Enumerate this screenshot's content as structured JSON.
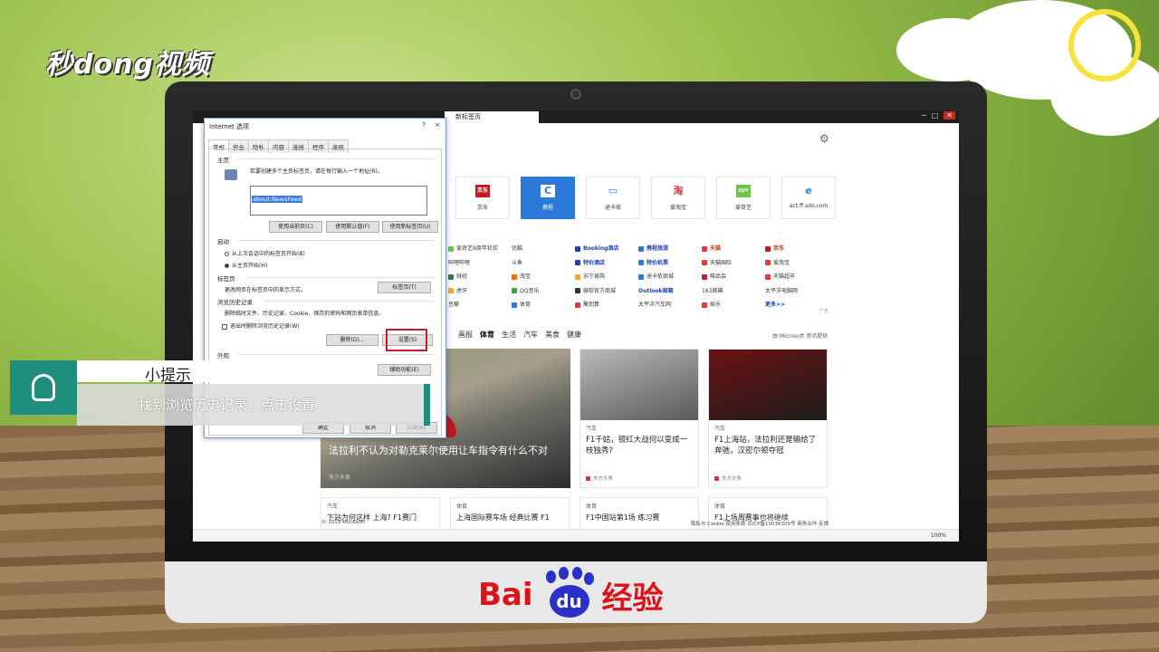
{
  "watermark": {
    "logo": "秒dong视频"
  },
  "brand": {
    "baidu_text": "Bai",
    "baidu_du": "du",
    "baidu_suffix": "经验"
  },
  "browser": {
    "tab_label": "新标签页",
    "window_buttons": [
      "─",
      "□",
      "✕"
    ],
    "top_tiles": [
      {
        "label": "京东",
        "icon": "京东"
      },
      {
        "label": "携程",
        "icon": "C",
        "active": true
      },
      {
        "label": "途卡依",
        "icon": "▭"
      },
      {
        "label": "爱淘宝",
        "icon": "淘"
      },
      {
        "label": "爱奇艺",
        "icon": "iQIY"
      },
      {
        "label": "act.ff.sdo.com",
        "icon": "e"
      }
    ],
    "links": [
      [
        "爱奇艺9周年狂欢",
        "优酷",
        "Booking酒店",
        "携程旅游",
        "天猫",
        "京东"
      ],
      [
        "哔哩哔哩",
        "斗鱼",
        "特价酒店",
        "特价机票",
        "天猫国际",
        "爱淘宝"
      ],
      [
        "财经",
        "淘宝",
        "苏宁易购",
        "途卡依商城",
        "唯品会",
        "天猫超市"
      ],
      [
        "虎牙",
        "QQ音乐",
        "微软官方商城",
        "Outlook邮箱",
        "163邮箱",
        "太平洋电脑网"
      ],
      [
        "豆瓣",
        "体育",
        "聚划算",
        "太平洋汽车网",
        "娱乐",
        "更多>>"
      ]
    ],
    "ad_label": "广告",
    "nav": [
      "画报",
      "体育",
      "生活",
      "汽车",
      "美食",
      "健康"
    ],
    "nav_active": "体育",
    "ms_news": "由 Microsoft 资讯提供",
    "hero": {
      "title": "法拉利不认为对勒克莱尔使用让车指令有什么不对",
      "source": "东方头条"
    },
    "cards": [
      {
        "category": "汽车",
        "title": "F1千姑，银红大战何以变成一枝独秀?",
        "source": "东方头条"
      },
      {
        "category": "汽车",
        "title": "F1上海站，法拉利还是输给了奔驰，汉密尔顿夺冠",
        "source": "东方头条"
      }
    ],
    "mini_cards": [
      {
        "category": "汽车",
        "title": "下站为何这样 上海? F1赛门"
      },
      {
        "category": "体育",
        "title": "上海国际赛车场 经典比赛 F1"
      },
      {
        "category": "体育",
        "title": "F1中国站第1场 练习赛"
      },
      {
        "category": "体育",
        "title": "F1上场周赛事也将继续"
      }
    ],
    "footer": {
      "copyright": "© 2019 Microsoft",
      "links": "隐私与 Cookie   使用条款   京ICP备10036305号   商务合作   反馈"
    },
    "zoom": "100%"
  },
  "dialog": {
    "title": "Internet 选项",
    "help": "?",
    "close": "×",
    "tabs": [
      "常规",
      "安全",
      "隐私",
      "内容",
      "连接",
      "程序",
      "高级"
    ],
    "active_tab": "常规",
    "home_section": "主页",
    "home_desc": "若要创建多个主页标签页，请在每行输入一个地址(R)。",
    "home_url": "about:NewsFeed",
    "btn_use_current": "使用当前页(C)",
    "btn_use_default": "使用默认值(F)",
    "btn_use_new_tab": "使用新标签页(U)",
    "startup_section": "启动",
    "startup_opt1": "从上次会话中的标签页开始(B)",
    "startup_opt2": "从主页开始(H)",
    "tabs_section": "标签页",
    "tabs_desc": "更改网页在标签页中的显示方式。",
    "btn_tabs": "标签页(T)",
    "history_section": "浏览历史记录",
    "history_desc": "删除临时文件、历史记录、Cookie、保存的密码和网页表单信息。",
    "history_chk": "退出时删除浏览历史记录(W)",
    "btn_delete": "删除(D)...",
    "btn_settings": "设置(S)",
    "appearance_section": "外观",
    "btn_accessibility": "辅助功能(E)",
    "btn_ok": "确定",
    "btn_cancel": "取消",
    "btn_apply": "应用(A)"
  },
  "tip": {
    "heading": "小提示",
    "text": "找到浏览历史记录，点击设置"
  }
}
